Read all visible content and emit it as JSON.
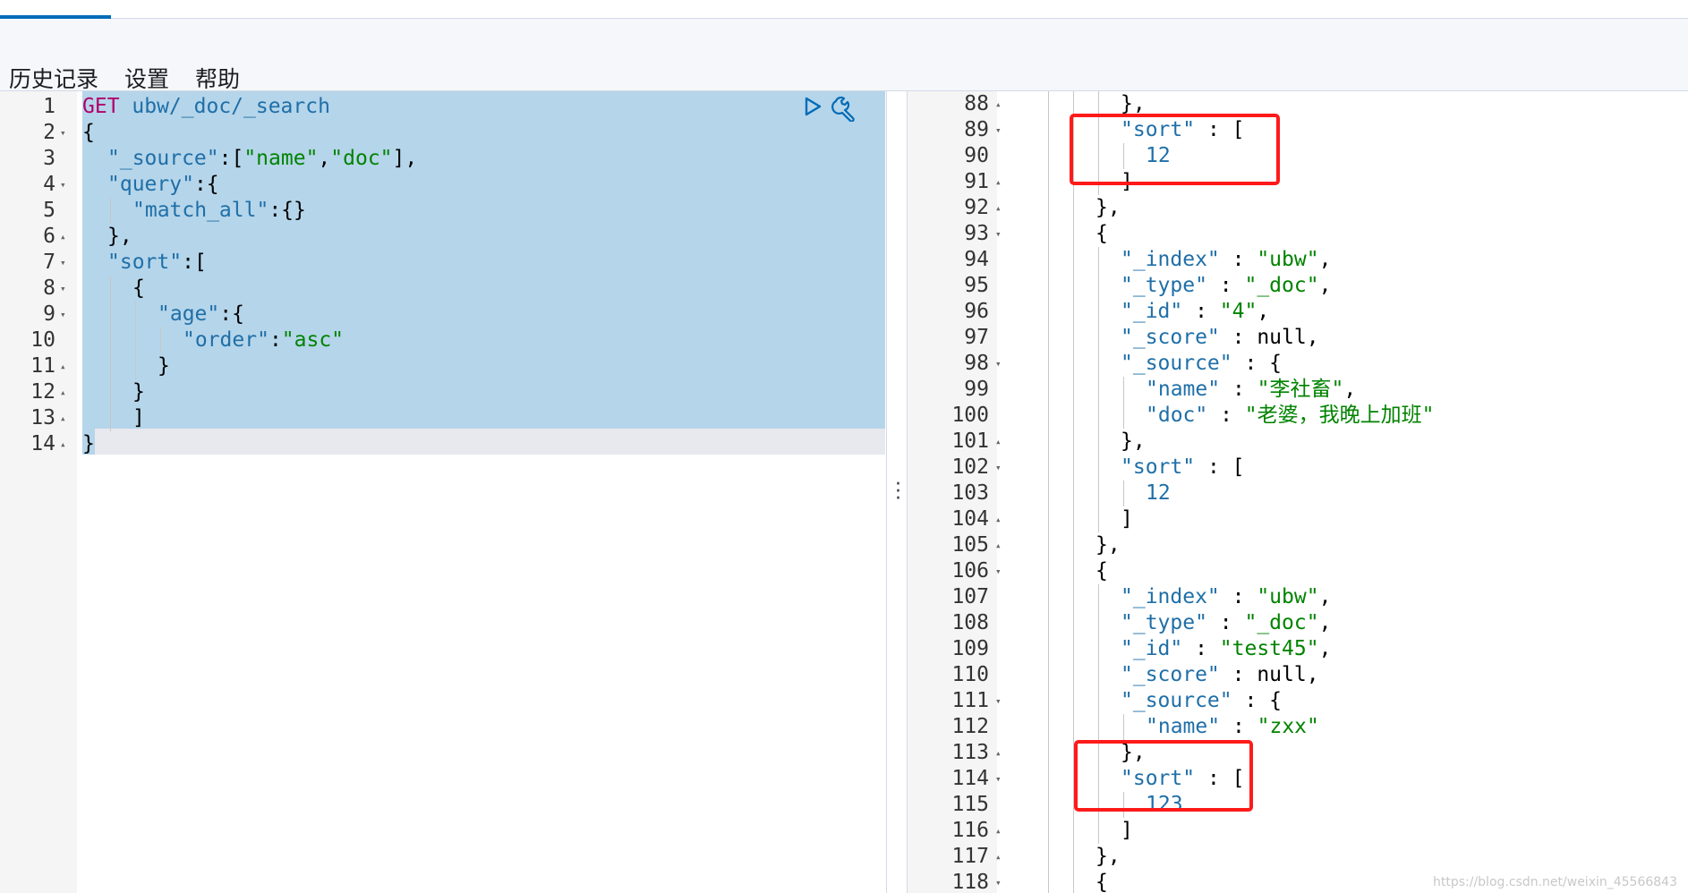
{
  "menu": {
    "history": "历史记录",
    "settings": "设置",
    "help": "帮助"
  },
  "request": {
    "lines": [
      {
        "n": "1",
        "fold": "",
        "indent": 0,
        "tokens": [
          {
            "t": "GET",
            "c": "m"
          },
          {
            "t": " ubw/_doc/_search",
            "c": "k"
          }
        ]
      },
      {
        "n": "2",
        "fold": "▾",
        "indent": 0,
        "tokens": [
          {
            "t": "{",
            "c": "p"
          }
        ]
      },
      {
        "n": "3",
        "fold": "",
        "indent": 1,
        "tokens": [
          {
            "t": "\"_source\"",
            "c": "k"
          },
          {
            "t": ":[",
            "c": "p"
          },
          {
            "t": "\"name\"",
            "c": "s"
          },
          {
            "t": ",",
            "c": "p"
          },
          {
            "t": "\"doc\"",
            "c": "s"
          },
          {
            "t": "],",
            "c": "p"
          }
        ]
      },
      {
        "n": "4",
        "fold": "▾",
        "indent": 1,
        "tokens": [
          {
            "t": "\"query\"",
            "c": "k"
          },
          {
            "t": ":{",
            "c": "p"
          }
        ]
      },
      {
        "n": "5",
        "fold": "",
        "indent": 2,
        "tokens": [
          {
            "t": "\"match_all\"",
            "c": "k"
          },
          {
            "t": ":{}",
            "c": "p"
          }
        ]
      },
      {
        "n": "6",
        "fold": "▴",
        "indent": 1,
        "tokens": [
          {
            "t": "},",
            "c": "p"
          }
        ]
      },
      {
        "n": "7",
        "fold": "▾",
        "indent": 1,
        "tokens": [
          {
            "t": "\"sort\"",
            "c": "k"
          },
          {
            "t": ":[",
            "c": "p"
          }
        ]
      },
      {
        "n": "8",
        "fold": "▾",
        "indent": 2,
        "tokens": [
          {
            "t": "{",
            "c": "p"
          }
        ]
      },
      {
        "n": "9",
        "fold": "▾",
        "indent": 3,
        "tokens": [
          {
            "t": "\"age\"",
            "c": "k"
          },
          {
            "t": ":{",
            "c": "p"
          }
        ]
      },
      {
        "n": "10",
        "fold": "",
        "indent": 4,
        "tokens": [
          {
            "t": "\"order\"",
            "c": "k"
          },
          {
            "t": ":",
            "c": "p"
          },
          {
            "t": "\"asc\"",
            "c": "s"
          }
        ]
      },
      {
        "n": "11",
        "fold": "▴",
        "indent": 3,
        "tokens": [
          {
            "t": "}",
            "c": "p"
          }
        ]
      },
      {
        "n": "12",
        "fold": "▴",
        "indent": 2,
        "tokens": [
          {
            "t": "}",
            "c": "p"
          }
        ]
      },
      {
        "n": "13",
        "fold": "▴",
        "indent": 2,
        "tokens": [
          {
            "t": "]",
            "c": "p"
          }
        ]
      },
      {
        "n": "14",
        "fold": "▴",
        "indent": 0,
        "tokens": [
          {
            "t": "}",
            "c": "p"
          }
        ]
      }
    ]
  },
  "response": {
    "lines": [
      {
        "n": "88",
        "fold": "▴",
        "indent": 4,
        "tokens": [
          {
            "t": "},",
            "c": "p"
          }
        ]
      },
      {
        "n": "89",
        "fold": "▾",
        "indent": 4,
        "tokens": [
          {
            "t": "\"sort\"",
            "c": "k"
          },
          {
            "t": " : [",
            "c": "p"
          }
        ]
      },
      {
        "n": "90",
        "fold": "",
        "indent": 5,
        "tokens": [
          {
            "t": "12",
            "c": "k"
          }
        ]
      },
      {
        "n": "91",
        "fold": "▴",
        "indent": 4,
        "tokens": [
          {
            "t": "]",
            "c": "p"
          }
        ]
      },
      {
        "n": "92",
        "fold": "▴",
        "indent": 3,
        "tokens": [
          {
            "t": "},",
            "c": "p"
          }
        ]
      },
      {
        "n": "93",
        "fold": "▾",
        "indent": 3,
        "tokens": [
          {
            "t": "{",
            "c": "p"
          }
        ]
      },
      {
        "n": "94",
        "fold": "",
        "indent": 4,
        "tokens": [
          {
            "t": "\"_index\"",
            "c": "k"
          },
          {
            "t": " : ",
            "c": "p"
          },
          {
            "t": "\"ubw\"",
            "c": "s"
          },
          {
            "t": ",",
            "c": "p"
          }
        ]
      },
      {
        "n": "95",
        "fold": "",
        "indent": 4,
        "tokens": [
          {
            "t": "\"_type\"",
            "c": "k"
          },
          {
            "t": " : ",
            "c": "p"
          },
          {
            "t": "\"_doc\"",
            "c": "s"
          },
          {
            "t": ",",
            "c": "p"
          }
        ]
      },
      {
        "n": "96",
        "fold": "",
        "indent": 4,
        "tokens": [
          {
            "t": "\"_id\"",
            "c": "k"
          },
          {
            "t": " : ",
            "c": "p"
          },
          {
            "t": "\"4\"",
            "c": "s"
          },
          {
            "t": ",",
            "c": "p"
          }
        ]
      },
      {
        "n": "97",
        "fold": "",
        "indent": 4,
        "tokens": [
          {
            "t": "\"_score\"",
            "c": "k"
          },
          {
            "t": " : null,",
            "c": "p"
          }
        ]
      },
      {
        "n": "98",
        "fold": "▾",
        "indent": 4,
        "tokens": [
          {
            "t": "\"_source\"",
            "c": "k"
          },
          {
            "t": " : {",
            "c": "p"
          }
        ]
      },
      {
        "n": "99",
        "fold": "",
        "indent": 5,
        "tokens": [
          {
            "t": "\"name\"",
            "c": "k"
          },
          {
            "t": " : ",
            "c": "p"
          },
          {
            "t": "\"李社畜\"",
            "c": "s"
          },
          {
            "t": ",",
            "c": "p"
          }
        ]
      },
      {
        "n": "100",
        "fold": "",
        "indent": 5,
        "tokens": [
          {
            "t": "\"doc\"",
            "c": "k"
          },
          {
            "t": " : ",
            "c": "p"
          },
          {
            "t": "\"老婆，我晚上加班\"",
            "c": "s"
          }
        ]
      },
      {
        "n": "101",
        "fold": "▴",
        "indent": 4,
        "tokens": [
          {
            "t": "},",
            "c": "p"
          }
        ]
      },
      {
        "n": "102",
        "fold": "▾",
        "indent": 4,
        "tokens": [
          {
            "t": "\"sort\"",
            "c": "k"
          },
          {
            "t": " : [",
            "c": "p"
          }
        ]
      },
      {
        "n": "103",
        "fold": "",
        "indent": 5,
        "tokens": [
          {
            "t": "12",
            "c": "k"
          }
        ]
      },
      {
        "n": "104",
        "fold": "▴",
        "indent": 4,
        "tokens": [
          {
            "t": "]",
            "c": "p"
          }
        ]
      },
      {
        "n": "105",
        "fold": "▴",
        "indent": 3,
        "tokens": [
          {
            "t": "},",
            "c": "p"
          }
        ]
      },
      {
        "n": "106",
        "fold": "▾",
        "indent": 3,
        "tokens": [
          {
            "t": "{",
            "c": "p"
          }
        ]
      },
      {
        "n": "107",
        "fold": "",
        "indent": 4,
        "tokens": [
          {
            "t": "\"_index\"",
            "c": "k"
          },
          {
            "t": " : ",
            "c": "p"
          },
          {
            "t": "\"ubw\"",
            "c": "s"
          },
          {
            "t": ",",
            "c": "p"
          }
        ]
      },
      {
        "n": "108",
        "fold": "",
        "indent": 4,
        "tokens": [
          {
            "t": "\"_type\"",
            "c": "k"
          },
          {
            "t": " : ",
            "c": "p"
          },
          {
            "t": "\"_doc\"",
            "c": "s"
          },
          {
            "t": ",",
            "c": "p"
          }
        ]
      },
      {
        "n": "109",
        "fold": "",
        "indent": 4,
        "tokens": [
          {
            "t": "\"_id\"",
            "c": "k"
          },
          {
            "t": " : ",
            "c": "p"
          },
          {
            "t": "\"test45\"",
            "c": "s"
          },
          {
            "t": ",",
            "c": "p"
          }
        ]
      },
      {
        "n": "110",
        "fold": "",
        "indent": 4,
        "tokens": [
          {
            "t": "\"_score\"",
            "c": "k"
          },
          {
            "t": " : null,",
            "c": "p"
          }
        ]
      },
      {
        "n": "111",
        "fold": "▾",
        "indent": 4,
        "tokens": [
          {
            "t": "\"_source\"",
            "c": "k"
          },
          {
            "t": " : {",
            "c": "p"
          }
        ]
      },
      {
        "n": "112",
        "fold": "",
        "indent": 5,
        "tokens": [
          {
            "t": "\"name\"",
            "c": "k"
          },
          {
            "t": " : ",
            "c": "p"
          },
          {
            "t": "\"zxx\"",
            "c": "s"
          }
        ]
      },
      {
        "n": "113",
        "fold": "▴",
        "indent": 4,
        "tokens": [
          {
            "t": "},",
            "c": "p"
          }
        ]
      },
      {
        "n": "114",
        "fold": "▾",
        "indent": 4,
        "tokens": [
          {
            "t": "\"sort\"",
            "c": "k"
          },
          {
            "t": " : [",
            "c": "p"
          }
        ]
      },
      {
        "n": "115",
        "fold": "",
        "indent": 5,
        "tokens": [
          {
            "t": "123",
            "c": "k"
          }
        ]
      },
      {
        "n": "116",
        "fold": "▴",
        "indent": 4,
        "tokens": [
          {
            "t": "]",
            "c": "p"
          }
        ]
      },
      {
        "n": "117",
        "fold": "▴",
        "indent": 3,
        "tokens": [
          {
            "t": "},",
            "c": "p"
          }
        ]
      },
      {
        "n": "118",
        "fold": "▾",
        "indent": 3,
        "tokens": [
          {
            "t": "{",
            "c": "p"
          }
        ]
      }
    ]
  },
  "icons": {
    "run": "play-icon",
    "tools": "wrench-icon",
    "divider": "vertical-ellipsis-icon"
  },
  "colors": {
    "selection": "#b5d5ea",
    "key": "#1f6fa8",
    "string": "#008300",
    "method": "#b1006b",
    "highlight_box": "#ff1a1a",
    "tab_accent": "#006bb8"
  },
  "watermark": "https://blog.csdn.net/weixin_45566843"
}
